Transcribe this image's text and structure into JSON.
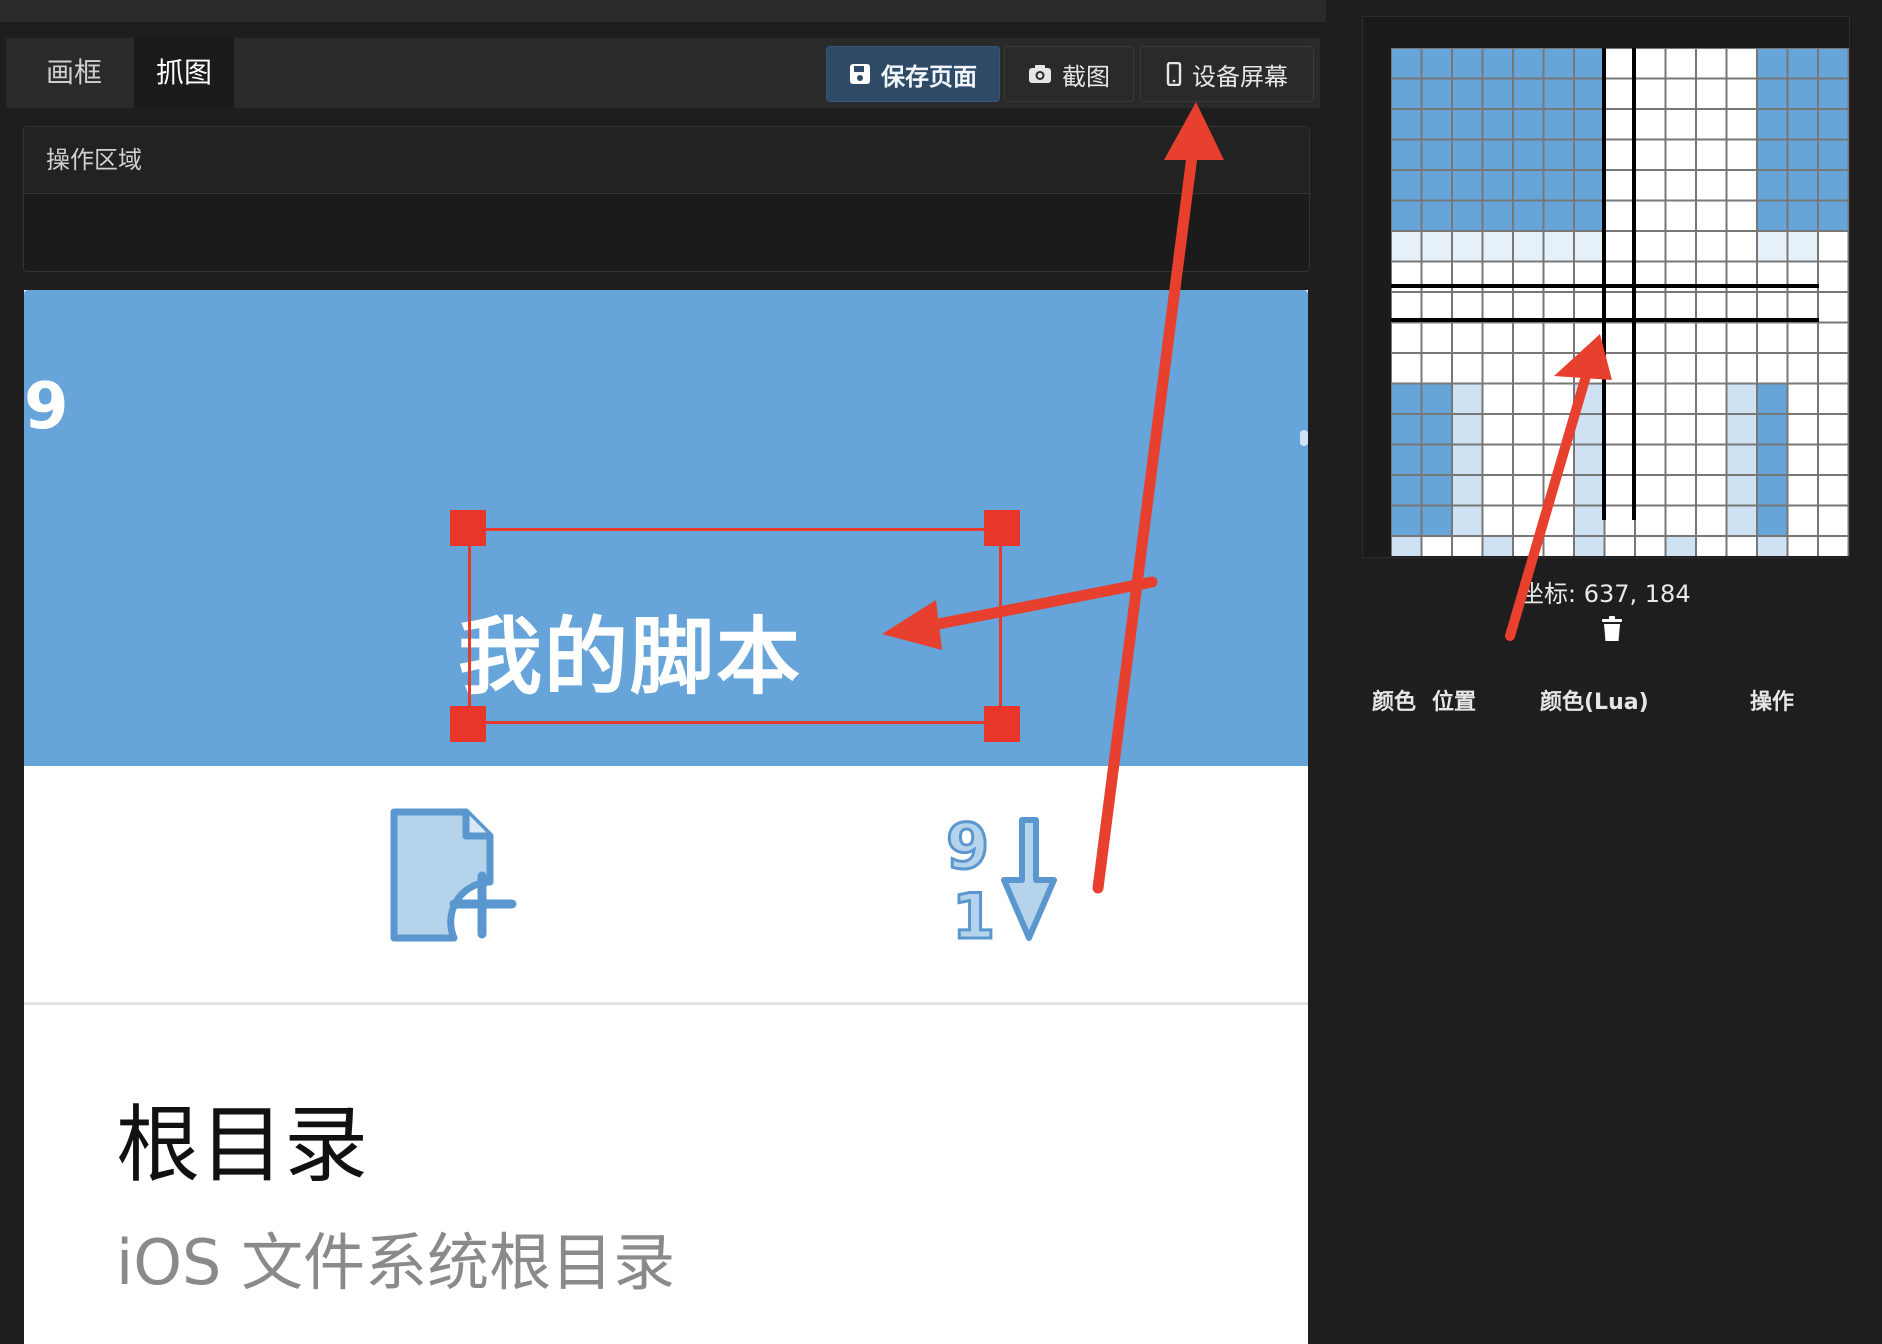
{
  "tabs": [
    {
      "label": "画框",
      "active": false
    },
    {
      "label": "抓图",
      "active": true
    }
  ],
  "toolbar": {
    "save_label": "保存页面",
    "screenshot_label": "截图",
    "device_screen_label": "设备屏幕"
  },
  "operation_panel": {
    "title": "操作区域"
  },
  "captured_screen": {
    "status_fragment": "9",
    "header_title": "我的脚本",
    "root_name": "根目录",
    "root_description": "iOS 文件系统根目录"
  },
  "magnifier": {
    "coordinate_text": "坐标: 637, 184"
  },
  "color_table": {
    "headers": [
      "颜色",
      "位置",
      "颜色(Lua)",
      "操作"
    ]
  },
  "colors": {
    "accent_blue": "#66a4da",
    "selection_red": "#e53b2e",
    "save_button": "#2f4a66",
    "background": "#1e1e1e"
  }
}
